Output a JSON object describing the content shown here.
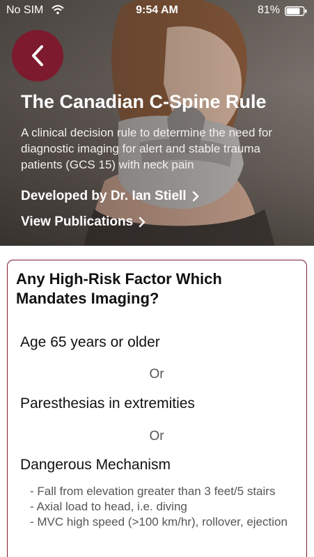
{
  "status_bar": {
    "carrier": "No SIM",
    "time": "9:54 AM",
    "battery": "81%",
    "battery_level": 0.81
  },
  "hero": {
    "title": "The Canadian C-Spine Rule",
    "subtitle": "A clinical decision rule to determine the need for diagnostic imaging for alert and stable trauma patients (GCS 15) with neck pain",
    "developer_link": "Developed by Dr. Ian Stiell",
    "publications_link": "View Publications"
  },
  "card": {
    "title": "Any High-Risk Factor Which Mandates Imaging?",
    "criteria": [
      "Age 65 years or older",
      "Paresthesias in extremities",
      "Dangerous Mechanism"
    ],
    "or_label": "Or",
    "mechanism_details": [
      "- Fall from elevation greater than 3 feet/5 stairs",
      "- Axial load to head, i.e. diving",
      "- MVC high speed (>100 km/hr), rollover, ejection"
    ]
  },
  "colors": {
    "accent": "#7d1a2d",
    "hero_text": "#ffffff"
  }
}
